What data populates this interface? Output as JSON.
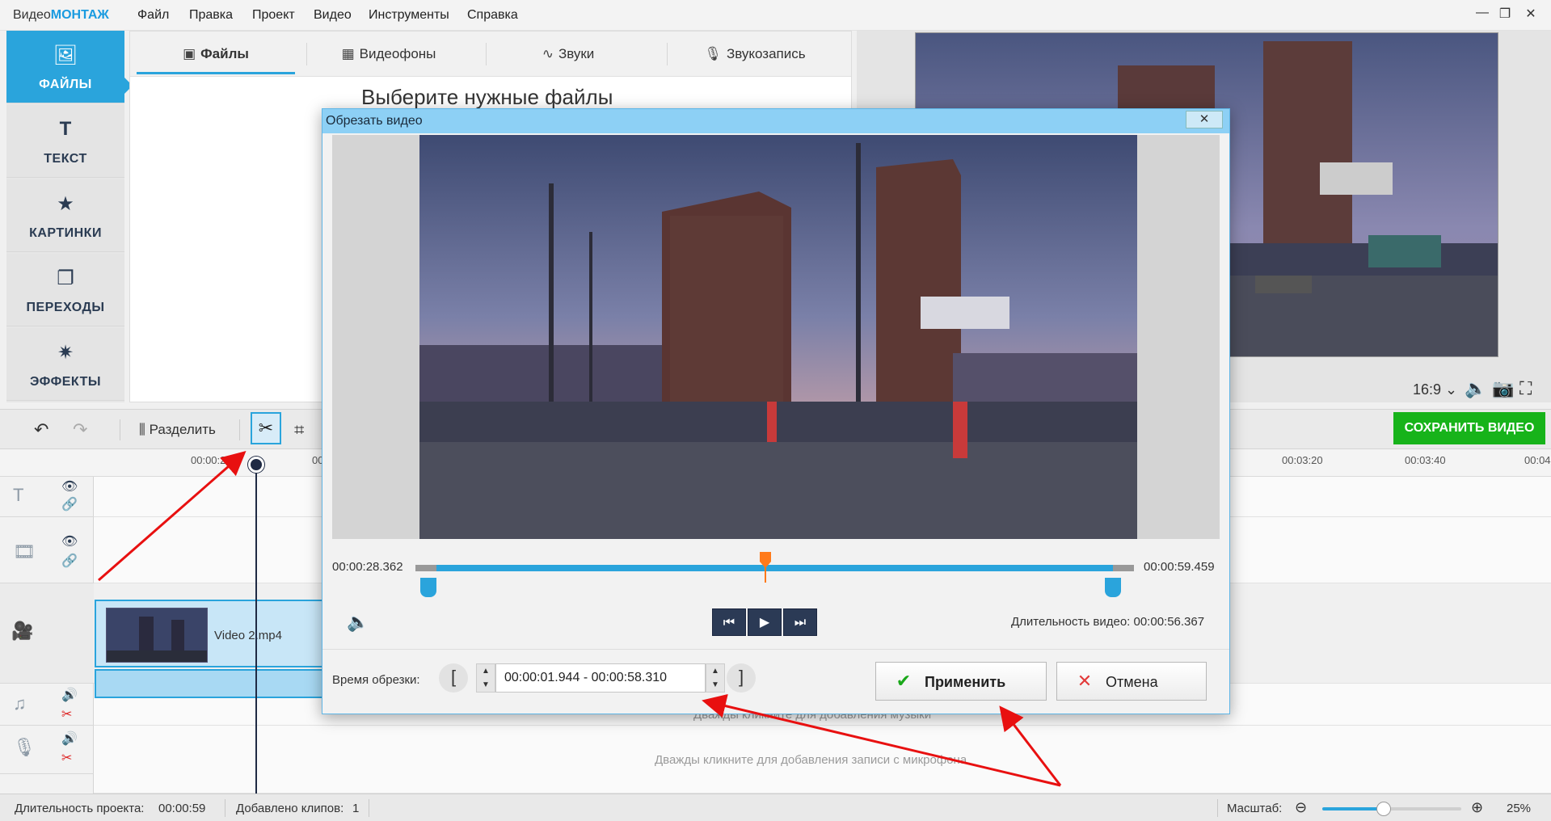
{
  "app": {
    "name_prefix": "Видео",
    "name_brand": "МОНТАЖ",
    "menu": [
      "Файл",
      "Правка",
      "Проект",
      "Видео",
      "Инструменты",
      "Справка"
    ],
    "window_controls": {
      "minimize": "—",
      "maximize": "❐",
      "close": "✕"
    }
  },
  "leftnav": {
    "items": [
      {
        "label": "ФАЙЛЫ",
        "icon": "image-icon",
        "glyph": "🖼"
      },
      {
        "label": "ТЕКСТ",
        "icon": "text-icon",
        "glyph": "T"
      },
      {
        "label": "КАРТИНКИ",
        "icon": "star-icon",
        "glyph": "★"
      },
      {
        "label": "ПЕРЕХОДЫ",
        "icon": "transitions-icon",
        "glyph": "❐"
      },
      {
        "label": "ЭФФЕКТЫ",
        "icon": "magic-wand-icon",
        "glyph": "✷"
      }
    ]
  },
  "library": {
    "tabs": [
      {
        "label": "Файлы",
        "glyph": "▣"
      },
      {
        "label": "Видеофоны",
        "glyph": "▦"
      },
      {
        "label": "Звуки",
        "glyph": "∿"
      },
      {
        "label": "Звукозапись",
        "glyph": "🎙"
      }
    ],
    "heading": "Выберите нужные файлы"
  },
  "preview": {
    "aspect_ratio": "16:9 ⌄"
  },
  "toolbar": {
    "undo": "↶",
    "redo": "↷",
    "split_label": "Разделить",
    "cut_glyph": "✂",
    "crop_glyph": "⌗",
    "save_label": "СОХРАНИТЬ ВИДЕО"
  },
  "timeline": {
    "ticks": [
      "00:00:20",
      "00",
      "00:03:20",
      "00:03:40",
      "00:04"
    ],
    "clip_name": "Video 2.mp4",
    "music_hint": "Дважды кликните для добавления музыки",
    "mic_hint": "Дважды кликните для добавления записи с микрофона"
  },
  "status": {
    "duration_label": "Длительность проекта:",
    "duration_value": "00:00:59",
    "clips_label": "Добавлено клипов:",
    "clips_value": "1",
    "zoom_label": "Масштаб:",
    "zoom_value": "25%",
    "zoom_level": 0.44
  },
  "dialog": {
    "title": "Обрезать видео",
    "close": "✕",
    "time_left": "00:00:28.362",
    "time_right": "00:00:59.459",
    "duration_text": "Длительность видео: 00:00:56.367",
    "trim_label": "Время обрезки:",
    "bracket_open": "[",
    "bracket_close": "]",
    "trim_value": "00:00:01.944 - 00:00:58.310",
    "apply_label": "Применить",
    "cancel_label": "Отмена",
    "controls": {
      "prev": "⏮",
      "play": "▶",
      "next": "⏭"
    }
  },
  "colors": {
    "accent": "#2aa4dc",
    "save_green": "#17b31a",
    "marker_orange": "#ff7a1a",
    "arrow_red": "#e81010"
  }
}
